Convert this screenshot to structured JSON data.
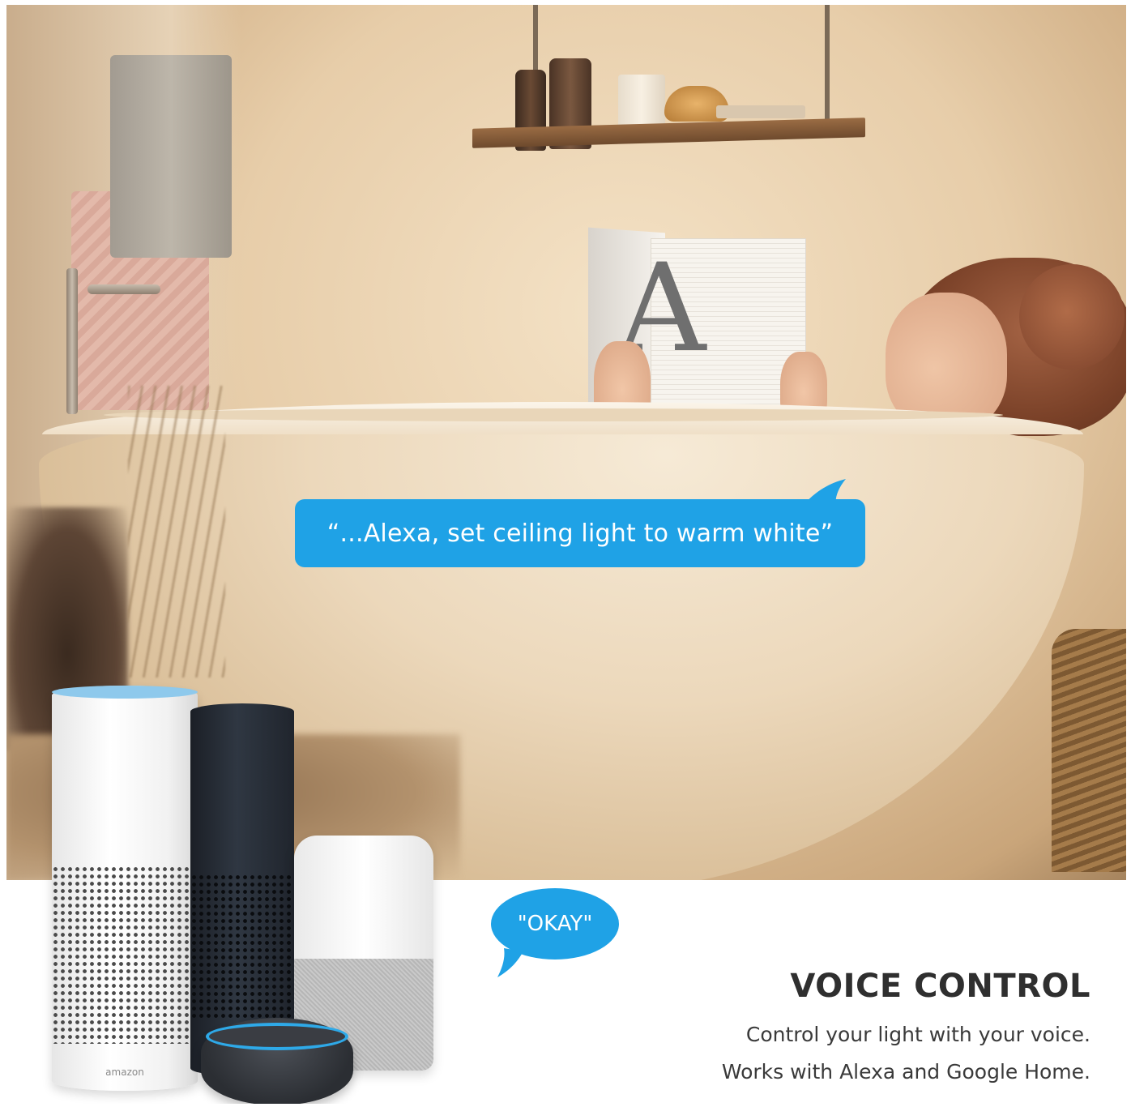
{
  "scene": {
    "bubble_main_text": "“...Alexa, set ceiling light to warm white”",
    "bubble_reply_text": "\"OKAY\"",
    "book_letter": "A",
    "device_logo": "amazon"
  },
  "info": {
    "headline": "VOICE CONTROL",
    "line1": "Control your light with your voice.",
    "line2": "Works with Alexa and Google Home."
  },
  "colors": {
    "bubble": "#1fa2e6",
    "headline": "#2f2f2f",
    "body_text": "#3a3a3a",
    "alexa_ring": "#2ea9e8"
  }
}
